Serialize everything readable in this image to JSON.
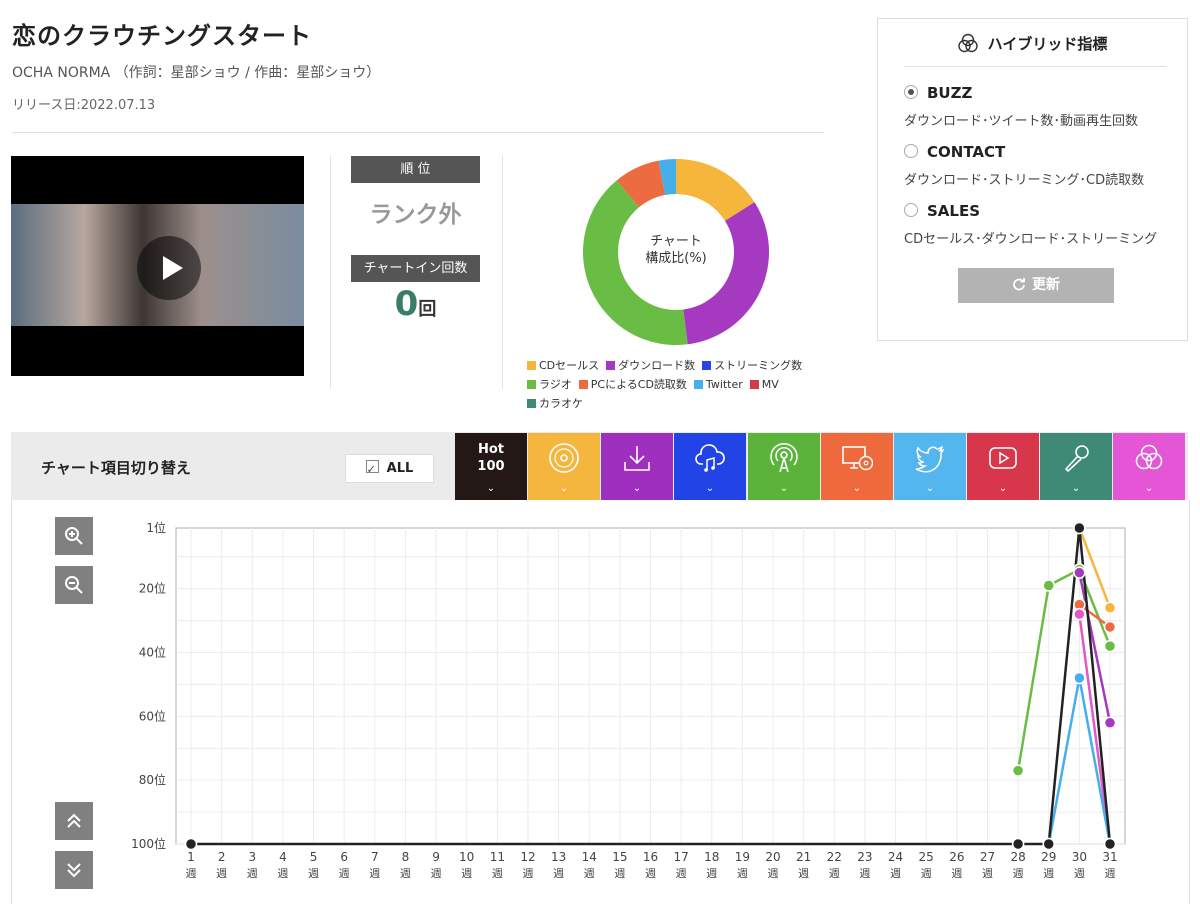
{
  "song": {
    "title": "恋のクラウチングスタート",
    "meta": "OCHA NORMA （作詞：星部ショウ / 作曲：星部ショウ）",
    "release": "リリース日:2022.07.13"
  },
  "stats": {
    "rank_label": "順 位",
    "rank_value": "ランク外",
    "chartin_label": "チャートイン回数",
    "chartin_count": "0",
    "chartin_unit": "回"
  },
  "donut": {
    "center_line1": "チャート",
    "center_line2": "構成比(%)",
    "segments": [
      {
        "name": "CDセールス",
        "value": 16,
        "color": "#f5b63b"
      },
      {
        "name": "ダウンロード数",
        "value": 32,
        "color": "#a53ac0"
      },
      {
        "name": "ラジオ",
        "value": 41,
        "color": "#69bd45"
      },
      {
        "name": "PCによるCD読取数",
        "value": 8,
        "color": "#ed6b40"
      },
      {
        "name": "Twitter",
        "value": 3,
        "color": "#46aeea"
      }
    ],
    "legend": [
      {
        "label": "CDセールス",
        "color": "#f5b63b"
      },
      {
        "label": "ダウンロード数",
        "color": "#a53ac0"
      },
      {
        "label": "ストリーミング数",
        "color": "#2845e8"
      },
      {
        "label": "ラジオ",
        "color": "#69bd45"
      },
      {
        "label": "PCによるCD読取数",
        "color": "#ed6b40"
      },
      {
        "label": "Twitter",
        "color": "#46aeea"
      },
      {
        "label": "MV",
        "color": "#d23a4a"
      },
      {
        "label": "カラオケ",
        "color": "#3d8a77"
      }
    ]
  },
  "hybrid": {
    "title": "ハイブリッド指標",
    "options": [
      {
        "label": "BUZZ",
        "desc": "ダウンロード･ツイート数･動画再生回数",
        "selected": true
      },
      {
        "label": "CONTACT",
        "desc": "ダウンロード･ストリーミング･CD読取数",
        "selected": false
      },
      {
        "label": "SALES",
        "desc": "CDセールス･ダウンロード･ストリーミング",
        "selected": false
      }
    ],
    "refresh_label": "更新"
  },
  "switcher": {
    "label": "チャート項目切り替え",
    "all_label": "ALL",
    "hot_line1": "Hot",
    "hot_line2": "100",
    "categories": [
      {
        "icon": "hot100-icon",
        "color": "#231815"
      },
      {
        "icon": "cd-icon",
        "color": "#f4b63d"
      },
      {
        "icon": "download-icon",
        "color": "#9e2fbf"
      },
      {
        "icon": "cloud-music-icon",
        "color": "#2244e6"
      },
      {
        "icon": "radio-icon",
        "color": "#5bb33c"
      },
      {
        "icon": "pc-cd-icon",
        "color": "#ee6a3d"
      },
      {
        "icon": "twitter-icon",
        "color": "#53b6ef"
      },
      {
        "icon": "play-icon",
        "color": "#d8364b"
      },
      {
        "icon": "microphone-icon",
        "color": "#3f8a77"
      },
      {
        "icon": "circles-icon",
        "color": "#e556d6"
      }
    ]
  },
  "chart_data": {
    "type": "line",
    "ylim": [
      1,
      100
    ],
    "y_inverted": true,
    "yticks": [
      "1位",
      "20位",
      "40位",
      "60位",
      "80位",
      "100位"
    ],
    "ytick_values": [
      1,
      20,
      40,
      60,
      80,
      100
    ],
    "x": [
      1,
      2,
      3,
      4,
      5,
      6,
      7,
      8,
      9,
      10,
      11,
      12,
      13,
      14,
      15,
      16,
      17,
      18,
      19,
      20,
      21,
      22,
      23,
      24,
      25,
      26,
      27,
      28,
      29,
      30,
      31
    ],
    "x_unit": "週",
    "series": [
      {
        "color": "#69bd45",
        "points": [
          [
            28,
            77
          ],
          [
            29,
            19
          ],
          [
            30,
            14
          ],
          [
            31,
            38
          ]
        ]
      },
      {
        "color": "#f5b63b",
        "points": [
          [
            30,
            1
          ],
          [
            31,
            26
          ]
        ]
      },
      {
        "color": "#ed6b40",
        "points": [
          [
            30,
            25
          ],
          [
            31,
            32
          ]
        ]
      },
      {
        "color": "#e357c9",
        "points": [
          [
            30,
            28
          ],
          [
            31,
            100
          ]
        ]
      },
      {
        "color": "#a53ac0",
        "points": [
          [
            30,
            15
          ],
          [
            31,
            62
          ]
        ]
      },
      {
        "color": "#46aeea",
        "points": [
          [
            29,
            100
          ],
          [
            30,
            48
          ],
          [
            31,
            100
          ]
        ]
      },
      {
        "color": "#222222",
        "points": [
          [
            1,
            100
          ],
          [
            28,
            100
          ],
          [
            29,
            100
          ],
          [
            30,
            1
          ],
          [
            31,
            100
          ]
        ]
      }
    ]
  }
}
